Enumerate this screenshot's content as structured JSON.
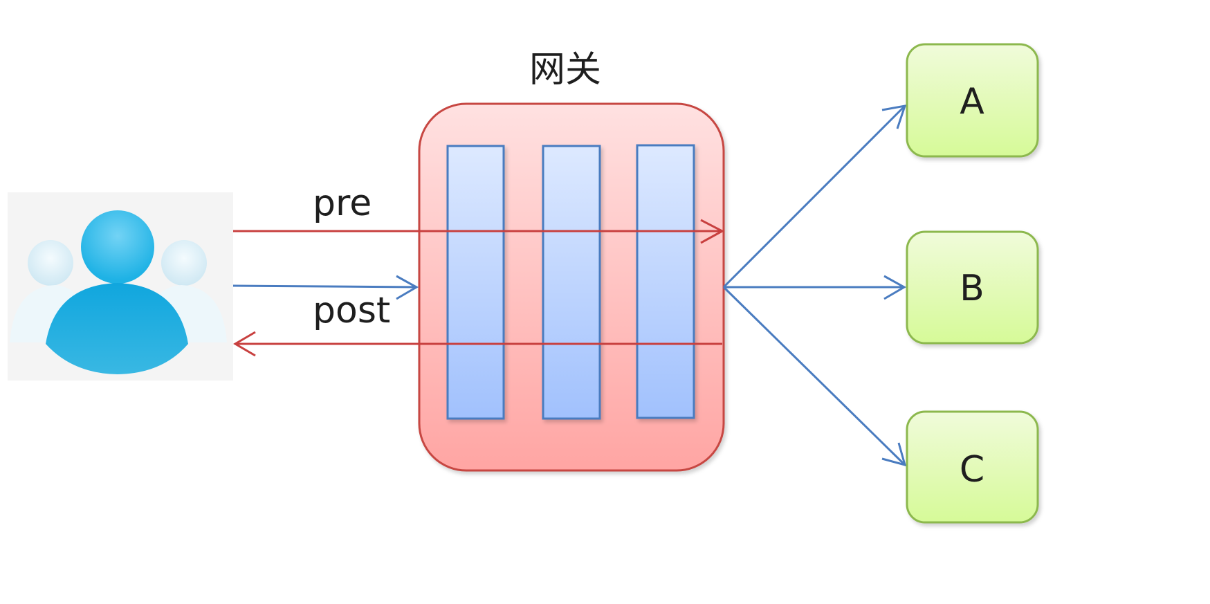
{
  "gateway": {
    "title": "网关",
    "filter_count": 3
  },
  "flows": {
    "pre_label": "pre",
    "post_label": "post"
  },
  "client": {
    "icon": "users-icon"
  },
  "services": [
    {
      "label": "A"
    },
    {
      "label": "B"
    },
    {
      "label": "C"
    }
  ],
  "colors": {
    "gateway_border": "#c74643",
    "gateway_fill_top": "#ffe1e1",
    "gateway_fill_bottom": "#ffa5a3",
    "filter_border": "#4a7cc0",
    "filter_fill_top": "#dde9ff",
    "filter_fill_bottom": "#a1c1fd",
    "service_border": "#8cb84e",
    "service_fill_top": "#f0fbda",
    "service_fill_bottom": "#d6fa98",
    "pre_arrow": "#c8403f",
    "post_arrow": "#c8403f",
    "request_arrow": "#4a7cc0",
    "route_arrow": "#4a7cc0",
    "user_icon_main": "#1aa8df",
    "user_icon_side": "#d8eef7"
  }
}
